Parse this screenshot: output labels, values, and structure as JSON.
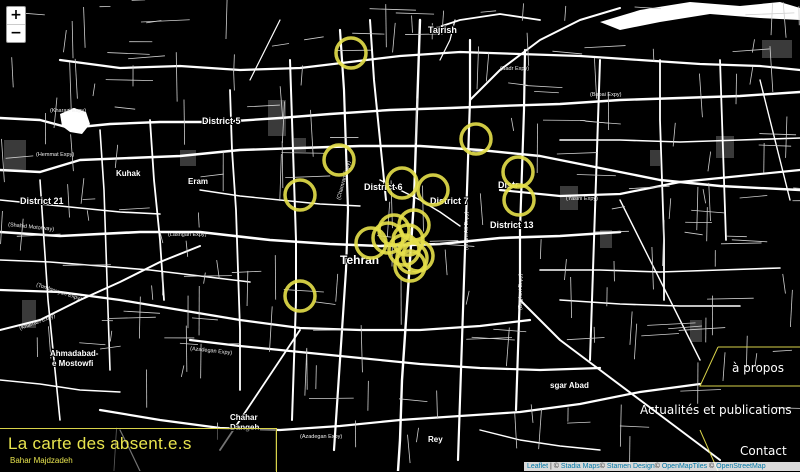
{
  "zoom": {
    "in_label": "+",
    "out_label": "−"
  },
  "map": {
    "labels": [
      {
        "id": "tajrish",
        "text": "Tajrish"
      },
      {
        "id": "district5",
        "text": "District 5"
      },
      {
        "id": "kuhak",
        "text": "Kuhak"
      },
      {
        "id": "eram",
        "text": "Eram"
      },
      {
        "id": "district21",
        "text": "District 21"
      },
      {
        "id": "district6",
        "text": "District 6"
      },
      {
        "id": "district7",
        "text": "District 7"
      },
      {
        "id": "district13",
        "text": "District 13"
      },
      {
        "id": "distr",
        "text": "Distr"
      },
      {
        "id": "tehran",
        "text": "Tehran"
      },
      {
        "id": "ahmadabad",
        "text": "Ahmadabad-"
      },
      {
        "id": "mostowfi",
        "text": "e Mostowfi"
      },
      {
        "id": "chahar",
        "text": "Chahar"
      },
      {
        "id": "dangeh",
        "text": "Dangeh"
      },
      {
        "id": "rey",
        "text": "Rey"
      },
      {
        "id": "sgarabad",
        "text": "sgar Abad"
      },
      {
        "id": "kharazi",
        "text": "(Kharazi Expy)"
      },
      {
        "id": "hemmat",
        "text": "(Hemmat Expy)"
      },
      {
        "id": "shahid",
        "text": "(Shahid Motorway)"
      },
      {
        "id": "lashgari",
        "text": "(Lashgari Expy)"
      },
      {
        "id": "yasini",
        "text": "(Yasini Expy)"
      },
      {
        "id": "azadegan",
        "text": "(Azadegan Expy)"
      },
      {
        "id": "azadegan2",
        "text": "(Azadegan Expy)"
      },
      {
        "id": "babai",
        "text": "(Babai Expy)"
      },
      {
        "id": "imam",
        "text": "(Imam Ali Expy)"
      },
      {
        "id": "chamran",
        "text": "(Chamran Expy)"
      },
      {
        "id": "sadr",
        "text": "(Sadr Expy)"
      },
      {
        "id": "tondgouyan",
        "text": "(Tondgouyan Expy)"
      },
      {
        "id": "khorramshahr",
        "text": "(Kharrazi Expy)"
      },
      {
        "id": "bagheri",
        "text": "(Bagheri Expy)"
      }
    ],
    "marker_count": 18
  },
  "title": "La carte des absent.e.s",
  "author": "Bahar Majdzadeh",
  "menu": {
    "apropos": "à propos",
    "actualites": "Actualités et publications",
    "contact": "Contact"
  },
  "attribution": {
    "leaflet": "Leaflet",
    "sep1": " | © ",
    "stadia": "Stadia Maps",
    "sep2": "© ",
    "stamen": "Stamen Design",
    "sep3": "© ",
    "omt": "OpenMapTiles",
    "sep4": " © ",
    "osm": "OpenStreetMap"
  },
  "colors": {
    "marker": "#e6e04a",
    "road": "#ffffff",
    "background": "#000000",
    "accent": "#d8d24a"
  }
}
